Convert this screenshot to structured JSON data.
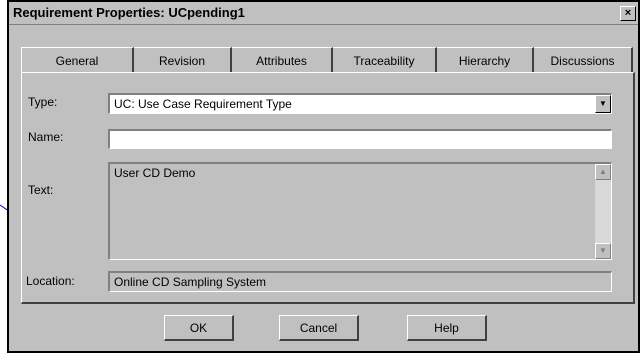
{
  "window": {
    "title": "Requirement Properties: UCpending1",
    "close_glyph": "×"
  },
  "tabs": [
    {
      "label": "General",
      "active": true
    },
    {
      "label": "Revision",
      "active": false
    },
    {
      "label": "Attributes",
      "active": false
    },
    {
      "label": "Traceability",
      "active": false
    },
    {
      "label": "Hierarchy",
      "active": false
    },
    {
      "label": "Discussions",
      "active": false
    }
  ],
  "form": {
    "type_label": "Type:",
    "type_value": "UC: Use Case Requirement Type",
    "name_label": "Name:",
    "name_value": "",
    "text_label": "Text:",
    "text_value": "User CD Demo",
    "location_label": "Location:",
    "location_value": "Online CD Sampling System"
  },
  "buttons": {
    "ok": "OK",
    "cancel": "Cancel",
    "help": "Help"
  },
  "icons": {
    "dropdown": "dropdown-arrow-icon",
    "scroll_up": "scroll-up-icon",
    "scroll_down": "scroll-down-icon"
  },
  "colors": {
    "face": "#c0c0c0",
    "pointer_line": "#0000cc"
  }
}
